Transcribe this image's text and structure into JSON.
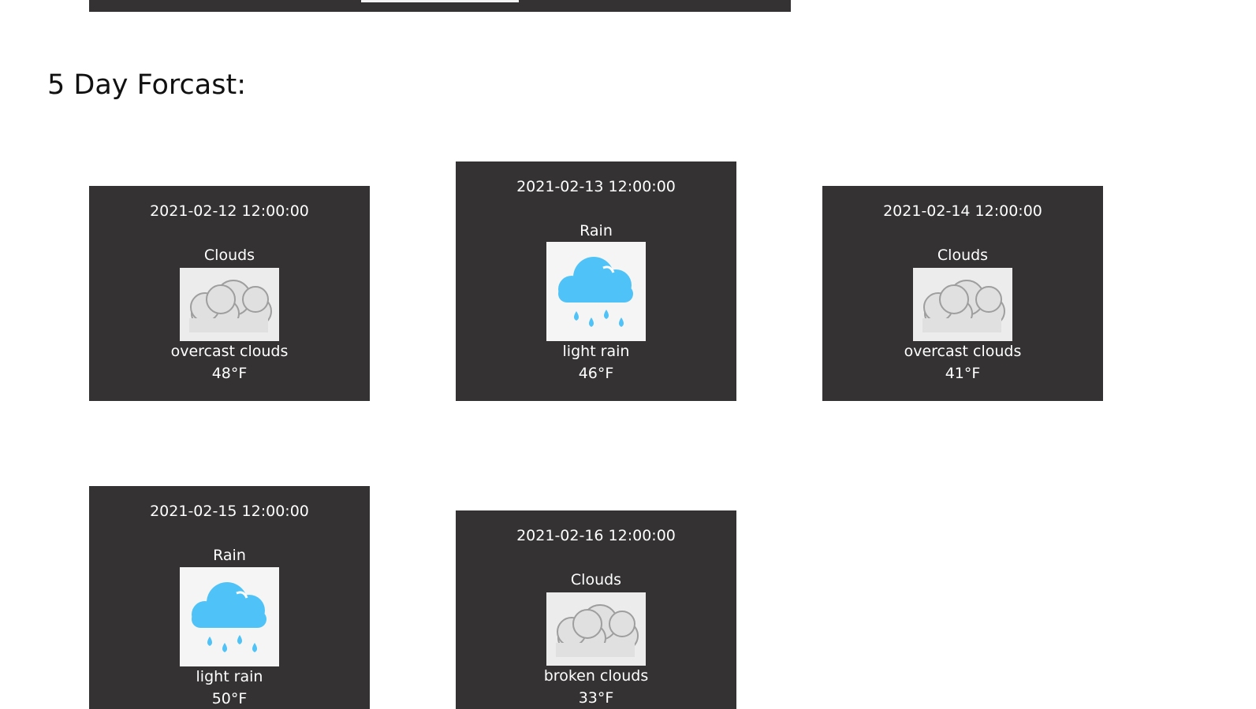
{
  "heading": "5 Day Forcast:",
  "forecast": [
    {
      "date": "2021-02-12 12:00:00",
      "main": "Clouds",
      "icon": "overcast-clouds-icon",
      "description": "overcast clouds",
      "temp": "48°F"
    },
    {
      "date": "2021-02-13 12:00:00",
      "main": "Rain",
      "icon": "light-rain-icon",
      "description": "light rain",
      "temp": "46°F"
    },
    {
      "date": "2021-02-14 12:00:00",
      "main": "Clouds",
      "icon": "overcast-clouds-icon",
      "description": "overcast clouds",
      "temp": "41°F"
    },
    {
      "date": "2021-02-15 12:00:00",
      "main": "Rain",
      "icon": "light-rain-icon",
      "description": "light rain",
      "temp": "50°F"
    },
    {
      "date": "2021-02-16 12:00:00",
      "main": "Clouds",
      "icon": "broken-clouds-icon",
      "description": "broken clouds",
      "temp": "33°F"
    }
  ],
  "colors": {
    "card_bg": "#343233",
    "card_text": "#ffffff",
    "rain_blue": "#4fc3f7"
  }
}
